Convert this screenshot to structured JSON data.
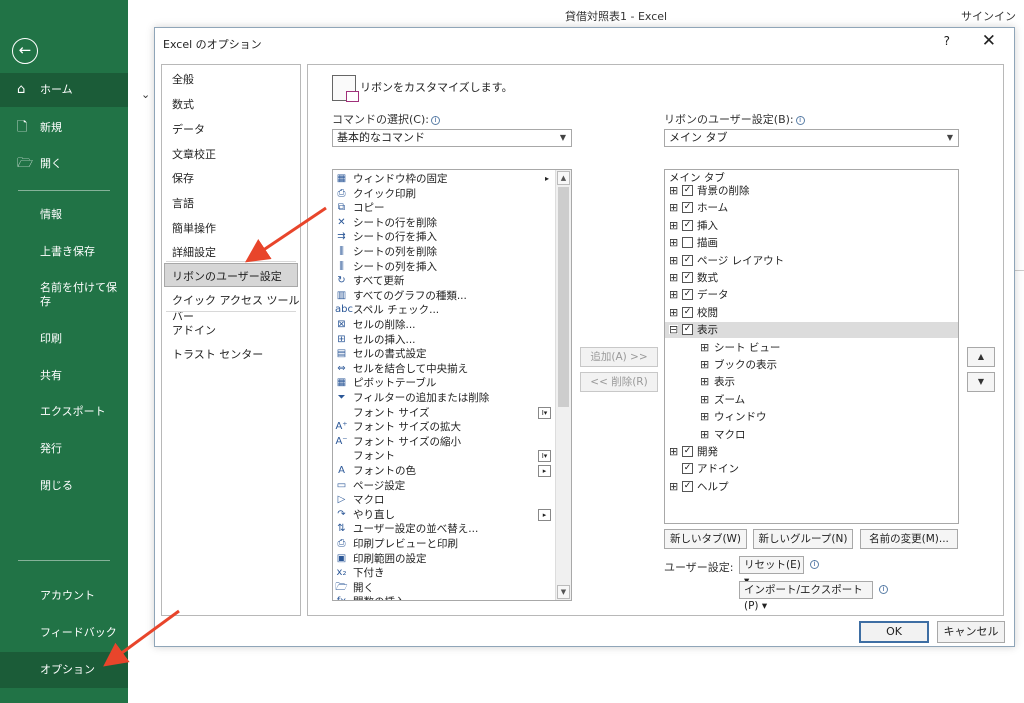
{
  "app": {
    "title": "貸借対照表1  -  Excel",
    "signin": "サインイン",
    "collapse": "⌄"
  },
  "sidebar": {
    "back_icon": "←",
    "home_icon": "⌂",
    "new_icon": "🗋",
    "open_icon": "🗁",
    "home": "ホーム",
    "new": "新規",
    "open": "開く",
    "items": [
      "情報",
      "上書き保存",
      "名前を付けて保存",
      "印刷",
      "共有",
      "エクスポート",
      "発行",
      "閉じる"
    ],
    "bottom": [
      "アカウント",
      "フィードバック",
      "オプション"
    ]
  },
  "dialog": {
    "title": "Excel のオプション",
    "help": "?",
    "close": "✕",
    "nav": [
      "全般",
      "数式",
      "データ",
      "文章校正",
      "保存",
      "言語",
      "簡単操作",
      "詳細設定",
      "リボンのユーザー設定",
      "クイック アクセス ツール バー",
      "アドイン",
      "トラスト センター"
    ],
    "heading": "リボンをカスタマイズします。",
    "commands_label": "コマンドの選択(C):",
    "commands_value": "基本的なコマンド",
    "ribbon_label": "リボンのユーザー設定(B):",
    "ribbon_value": "メイン タブ",
    "info_glyph": "i",
    "dropdown_arrow": "▼",
    "scroll_up": "▲",
    "scroll_down": "▼",
    "commands": [
      {
        "icon": "▦",
        "label": "ウィンドウ枠の固定",
        "extra": "▸"
      },
      {
        "icon": "⎙",
        "label": "クイック印刷"
      },
      {
        "icon": "⧉",
        "label": "コピー"
      },
      {
        "icon": "✕",
        "label": "シートの行を削除"
      },
      {
        "icon": "⇉",
        "label": "シートの行を挿入"
      },
      {
        "icon": "⫼",
        "label": "シートの列を削除"
      },
      {
        "icon": "⫼",
        "label": "シートの列を挿入"
      },
      {
        "icon": "↻",
        "label": "すべて更新"
      },
      {
        "icon": "▥",
        "label": "すべてのグラフの種類..."
      },
      {
        "icon": "abc",
        "label": "スペル チェック..."
      },
      {
        "icon": "⊠",
        "label": "セルの削除..."
      },
      {
        "icon": "⊞",
        "label": "セルの挿入..."
      },
      {
        "icon": "▤",
        "label": "セルの書式設定"
      },
      {
        "icon": "⇔",
        "label": "セルを結合して中央揃え"
      },
      {
        "icon": "▦",
        "label": "ピボットテーブル"
      },
      {
        "icon": "⏷",
        "label": "フィルターの追加または削除"
      },
      {
        "icon": "",
        "label": "フォント サイズ",
        "box": "I▾"
      },
      {
        "icon": "A⁺",
        "label": "フォント サイズの拡大"
      },
      {
        "icon": "A⁻",
        "label": "フォント サイズの縮小"
      },
      {
        "icon": "",
        "label": "フォント",
        "box": "I▾"
      },
      {
        "icon": "A",
        "label": "フォントの色",
        "box": "▸"
      },
      {
        "icon": "▭",
        "label": "ページ設定"
      },
      {
        "icon": "▷",
        "label": "マクロ"
      },
      {
        "icon": "↷",
        "label": "やり直し",
        "box": "▸"
      },
      {
        "icon": "⇅",
        "label": "ユーザー設定の並べ替え..."
      },
      {
        "icon": "⎙",
        "label": "印刷プレビューと印刷"
      },
      {
        "icon": "▣",
        "label": "印刷範囲の設定"
      },
      {
        "icon": "x₂",
        "label": "下付き"
      },
      {
        "icon": "🗁",
        "label": "開く"
      },
      {
        "icon": "fx",
        "label": "関数の挿入..."
      }
    ],
    "add_button": "追加(A) >>",
    "remove_button": "<< 削除(R)",
    "tree_header": "メイン タブ",
    "tree": [
      {
        "label": "背景の削除",
        "checked": true,
        "level": 0,
        "expand": "⊞"
      },
      {
        "label": "ホーム",
        "checked": true,
        "level": 0,
        "expand": "⊞"
      },
      {
        "label": "挿入",
        "checked": true,
        "level": 0,
        "expand": "⊞"
      },
      {
        "label": "描画",
        "checked": false,
        "level": 0,
        "expand": "⊞"
      },
      {
        "label": "ページ レイアウト",
        "checked": true,
        "level": 0,
        "expand": "⊞"
      },
      {
        "label": "数式",
        "checked": true,
        "level": 0,
        "expand": "⊞"
      },
      {
        "label": "データ",
        "checked": true,
        "level": 0,
        "expand": "⊞"
      },
      {
        "label": "校閲",
        "checked": true,
        "level": 0,
        "expand": "⊞"
      },
      {
        "label": "表示",
        "checked": true,
        "level": 0,
        "expand": "⊟",
        "highlight": true
      },
      {
        "label": "シート ビュー",
        "level": 1,
        "expand": "⊞"
      },
      {
        "label": "ブックの表示",
        "level": 1,
        "expand": "⊞"
      },
      {
        "label": "表示",
        "level": 1,
        "expand": "⊞"
      },
      {
        "label": "ズーム",
        "level": 1,
        "expand": "⊞"
      },
      {
        "label": "ウィンドウ",
        "level": 1,
        "expand": "⊞"
      },
      {
        "label": "マクロ",
        "level": 1,
        "expand": "⊞"
      },
      {
        "label": "開発",
        "checked": true,
        "level": 0,
        "expand": "⊞"
      },
      {
        "label": "アドイン",
        "checked": true,
        "level": 0,
        "expand": ""
      },
      {
        "label": "ヘルプ",
        "checked": true,
        "level": 0,
        "expand": "⊞"
      }
    ],
    "move_up": "▲",
    "move_down": "▼",
    "new_tab": "新しいタブ(W)",
    "new_group": "新しいグループ(N)",
    "rename": "名前の変更(M)...",
    "user_setting_label": "ユーザー設定:",
    "reset": "リセット(E) ▾",
    "import_export": "インポート/エクスポート(P) ▾",
    "ok": "OK",
    "cancel": "キャンセル"
  },
  "colors": {
    "sidebar": "#217346",
    "arrow": "#e8452b"
  }
}
